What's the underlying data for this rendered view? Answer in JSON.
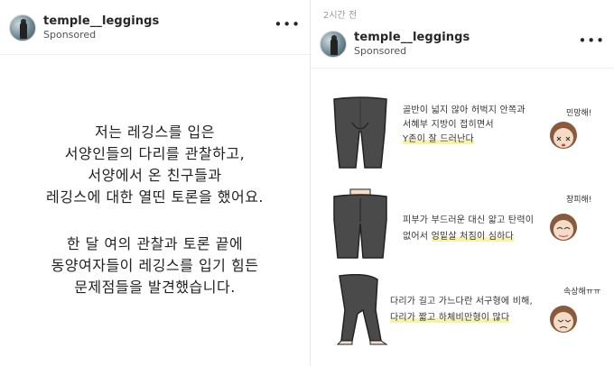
{
  "left_post": {
    "username": "temple__leggings",
    "sponsored": "Sponsored",
    "more_icon": "more-horizontal-icon",
    "paragraph1": [
      "저는 레깅스를 입은",
      "서양인들의 다리를 관찰하고,",
      "서양에서 온 친구들과",
      "레깅스에 대한 열띤 토론을 했어요."
    ],
    "paragraph2": [
      "한 달 여의 관찰과 토론 끝에",
      "동양여자들이 레깅스를 입기 힘든",
      "문제점들을 발견했습니다."
    ]
  },
  "right_post": {
    "time_ago": "2시간 전",
    "username": "temple__leggings",
    "sponsored": "Sponsored",
    "more_icon": "more-horizontal-icon",
    "panels": [
      {
        "lines": [
          "골반이 넓지 않아 허벅지 안쪽과",
          "서혜부 지방이 접히면서"
        ],
        "highlight": "Y존이 잘 드러난다",
        "reaction": "민망해!"
      },
      {
        "lines": [
          "피부가 부드러운 대신 얇고 탄력이"
        ],
        "prefix": "없어서 ",
        "highlight": "엉밑살 처짐이 심하다",
        "reaction": "창피해!"
      },
      {
        "lines": [
          "다리가 길고 가느다란 서구형에 비해,"
        ],
        "highlight": "다리가 짧고 하체비만형이 많다",
        "reaction": "속상해ㅠㅠ"
      }
    ]
  },
  "colors": {
    "legging": "#4a4a4a",
    "skin": "#f4dcc6",
    "hair": "#8a5a3c",
    "highlight": "#f6f3a8"
  }
}
